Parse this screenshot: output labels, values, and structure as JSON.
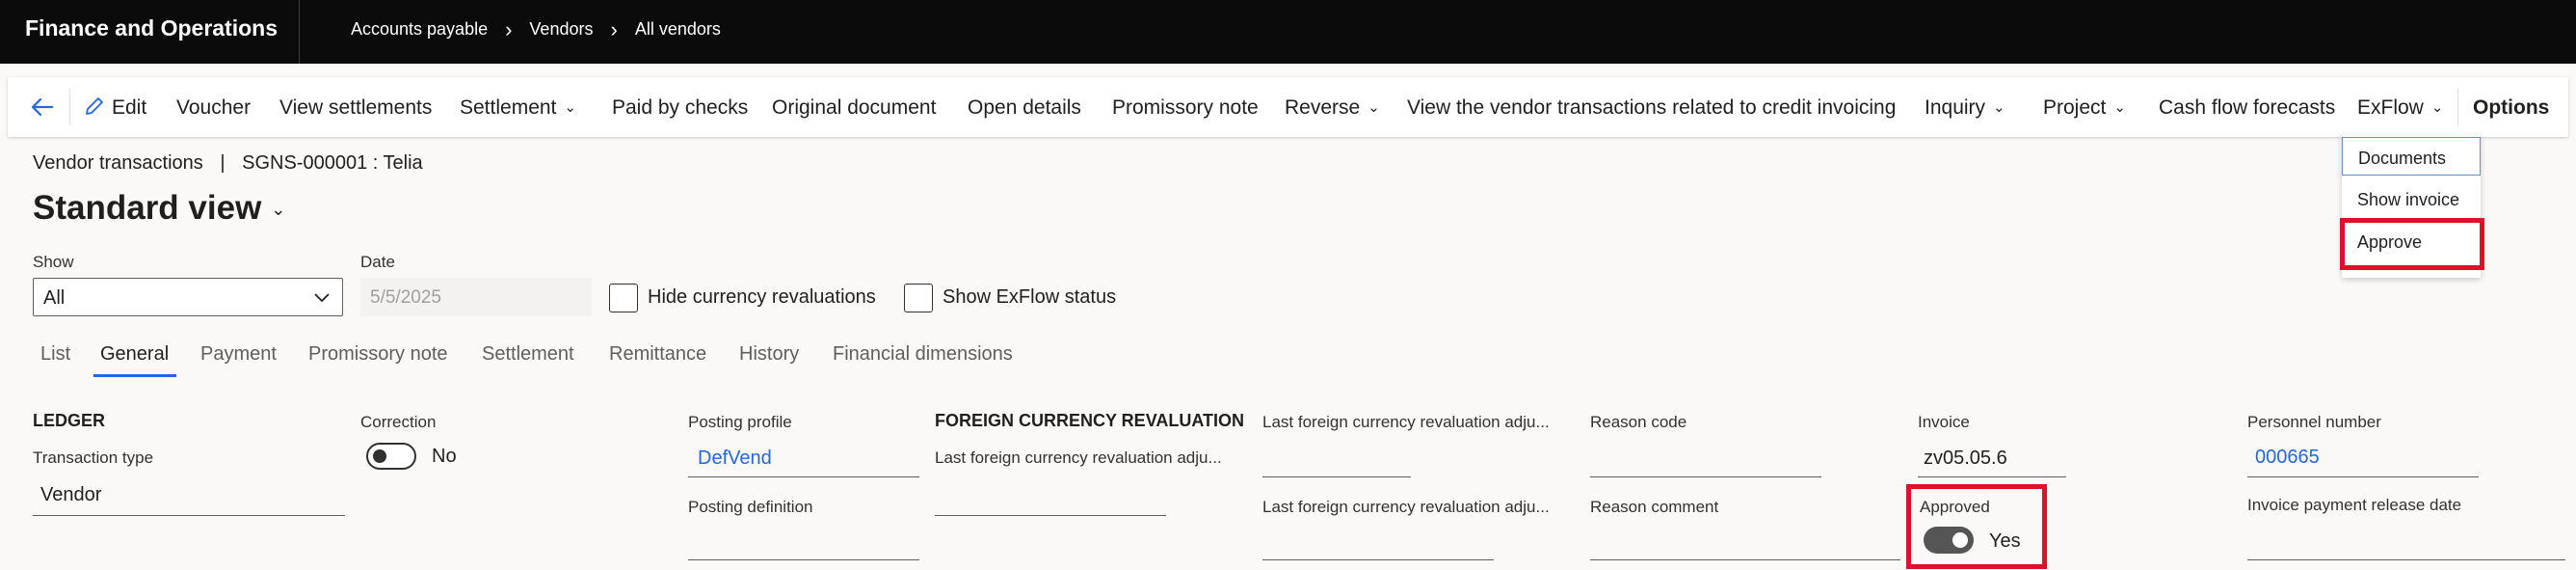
{
  "app": {
    "name": "Finance and Operations"
  },
  "breadcrumb": [
    "Accounts payable",
    "Vendors",
    "All vendors"
  ],
  "actionbar": {
    "edit": "Edit",
    "voucher": "Voucher",
    "view_settlements": "View settlements",
    "settlement": "Settlement",
    "paid_by_checks": "Paid by checks",
    "original_document": "Original document",
    "open_details": "Open details",
    "promissory_note": "Promissory note",
    "reverse": "Reverse",
    "view_credit": "View the vendor transactions related to credit invoicing",
    "inquiry": "Inquiry",
    "project": "Project",
    "cash_flow": "Cash flow forecasts",
    "exflow": "ExFlow",
    "options": "Options"
  },
  "exflow_menu": [
    "Documents",
    "Show invoice",
    "Approve"
  ],
  "page": {
    "context": "Vendor transactions",
    "separator": "|",
    "record": "SGNS-000001 : Telia",
    "view_title": "Standard view"
  },
  "filters": {
    "show_label": "Show",
    "show_value": "All",
    "date_label": "Date",
    "date_value": "5/5/2025",
    "hide_currency": "Hide currency revaluations",
    "show_exflow": "Show ExFlow status"
  },
  "tabs": [
    "List",
    "General",
    "Payment",
    "Promissory note",
    "Settlement",
    "Remittance",
    "History",
    "Financial dimensions"
  ],
  "fields": {
    "ledger_header": "LEDGER",
    "transaction_type_label": "Transaction type",
    "transaction_type_value": "Vendor",
    "correction_label": "Correction",
    "correction_value": "No",
    "posting_profile_label": "Posting profile",
    "posting_profile_value": "DefVend",
    "posting_definition_label": "Posting definition",
    "fcr_header": "FOREIGN CURRENCY REVALUATION",
    "fcr_adj_label": "Last foreign currency revaluation adju...",
    "fcr_adj_label2": "Last foreign currency revaluation adju...",
    "fcr_adj_label3": "Last foreign currency revaluation adju...",
    "reason_code_label": "Reason code",
    "reason_comment_label": "Reason comment",
    "invoice_label": "Invoice",
    "invoice_value": "zv05.05.6",
    "approved_label": "Approved",
    "approved_value": "Yes",
    "personnel_label": "Personnel number",
    "personnel_value": "000665",
    "release_date_label": "Invoice payment release date"
  },
  "colors": {
    "accent": "#2266e3",
    "highlight": "#e0102b",
    "topbar": "#0b0b0b"
  }
}
